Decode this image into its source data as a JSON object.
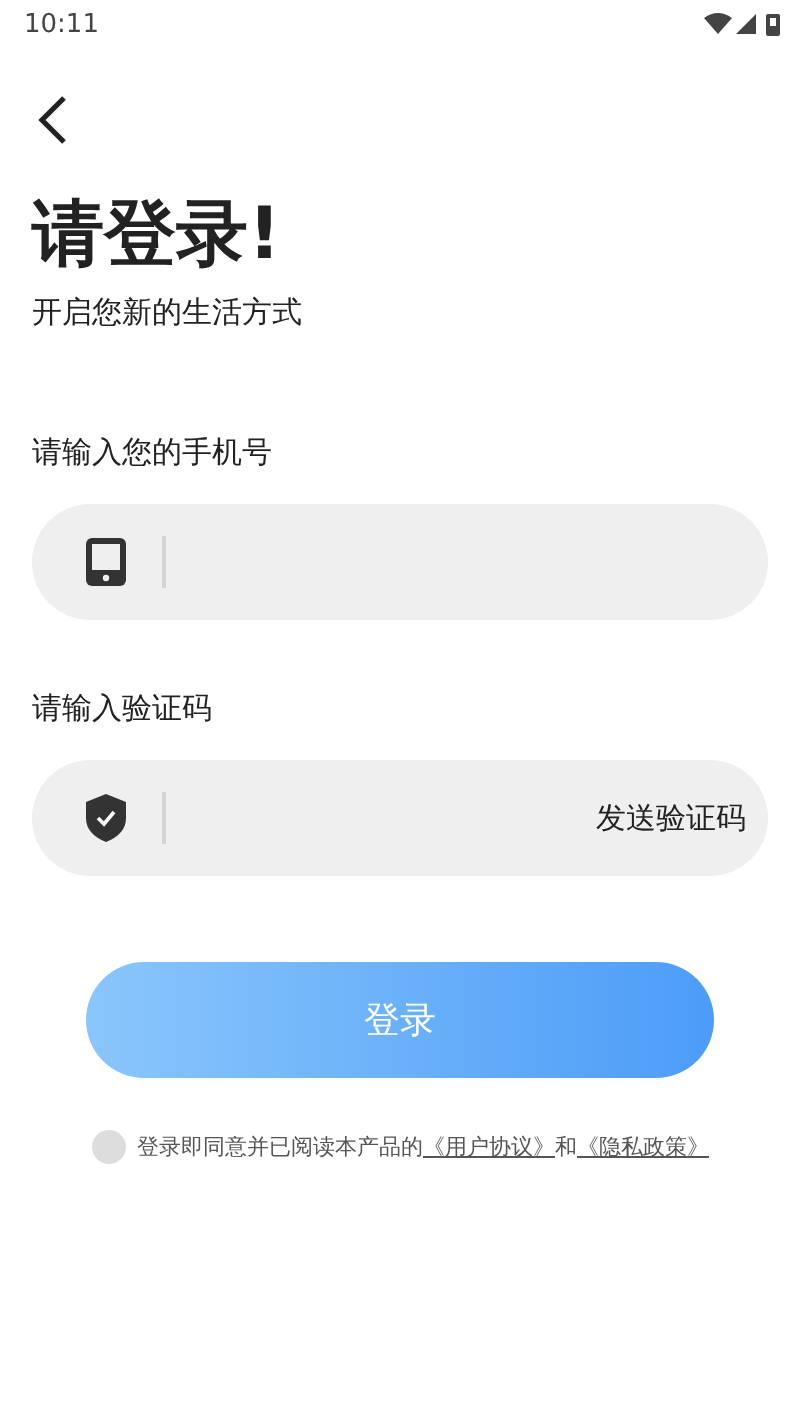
{
  "status_bar": {
    "time": "10:11"
  },
  "title": "请登录!",
  "subtitle": "开启您新的生活方式",
  "fields": [
    {
      "label": "请输入您的手机号",
      "kind": "phone"
    },
    {
      "label": "请输入验证码",
      "kind": "code",
      "action": "发送验证码"
    }
  ],
  "login_button": "登录",
  "agreement": {
    "checked": false,
    "text": "登录即同意并已阅读本产品的",
    "links": [
      "《用户协议》",
      "《隐私政策》"
    ],
    "joiner": "和"
  }
}
